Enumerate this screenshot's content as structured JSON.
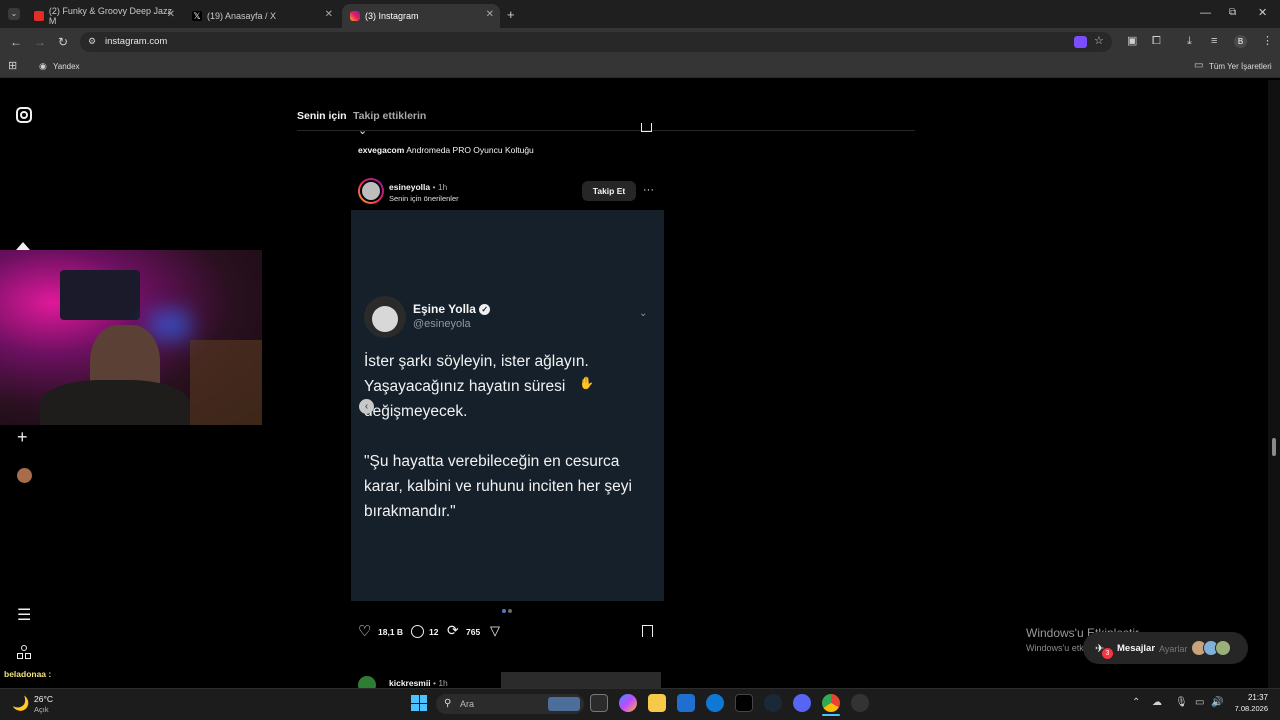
{
  "browser": {
    "tabs": [
      {
        "title": "(2) Funky & Groovy Deep Jazz M",
        "active": false
      },
      {
        "title": "(19) Anasayfa / X",
        "active": false
      },
      {
        "title": "(3) Instagram",
        "active": true
      }
    ],
    "url": "instagram.com",
    "bookmarks": {
      "item": "Yandex",
      "all_bookmarks": "Tüm Yer İşaretleri"
    },
    "profile_letter": "B"
  },
  "instagram": {
    "feed_tabs": {
      "for_you": "Senin için",
      "following": "Takip ettiklerin"
    },
    "prev_caption": {
      "user": "exvegacom",
      "text": "Andromeda PRO Oyuncu Koltuğu"
    },
    "post": {
      "username": "esineyolla",
      "time": "1h",
      "subtitle": "Senin için önerilenler",
      "follow_label": "Takip Et",
      "tweet": {
        "display_name": "Eşine Yolla",
        "handle": "@esineyola",
        "line1": "İster şarkı söyleyin, ister ağlayın.",
        "line2": "Yaşayacağınız hayatın süresi",
        "line3": "değişmeyecek.",
        "quote1": "\"Şu hayatta verebileceğin en cesurca",
        "quote2": "karar, kalbini ve ruhunu inciten her şeyi",
        "quote3": "bırakmandır.\""
      },
      "likes": "18,1 B",
      "comments": "12",
      "reposts": "765"
    },
    "next_post": {
      "username": "kickresmii",
      "time": "1h"
    },
    "chat_user": "beladonaa :",
    "messages_label": "Mesajlar",
    "messages_badge": "3"
  },
  "windows_watermark": {
    "title": "Windows'u Etkinleştir",
    "sub": "Windows'u etki",
    "sub2": "Ayarlar"
  },
  "taskbar": {
    "weather_temp": "26°C",
    "weather_desc": "Açık",
    "search_placeholder": "Ara",
    "time": "21:37",
    "date": "7.08.2026"
  },
  "colors": {
    "accent_blue": "#4a7bd6",
    "tweet_bg": "#15202b"
  }
}
